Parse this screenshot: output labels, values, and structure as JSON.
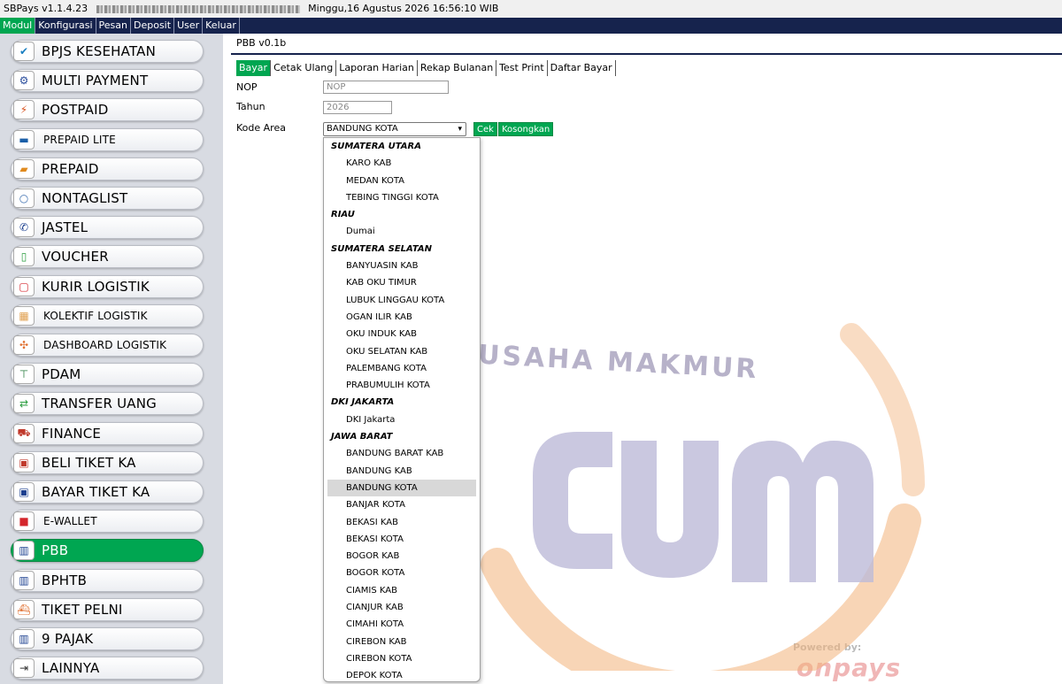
{
  "titlebar": {
    "app": "SBPays v1.1.4.23",
    "datetime": "Minggu,16 Agustus 2026 16:56:10 WIB"
  },
  "menu": [
    {
      "label": "Modul",
      "active": true
    },
    {
      "label": "Konfigurasi",
      "active": false
    },
    {
      "label": "Pesan",
      "active": false
    },
    {
      "label": "Deposit",
      "active": false
    },
    {
      "label": "User",
      "active": false
    },
    {
      "label": "Keluar",
      "active": false
    }
  ],
  "sidebar": {
    "items": [
      {
        "label": "BPJS KESEHATAN",
        "icon": "check-badge-icon",
        "glyph": "✔",
        "color": "#1a7fc1"
      },
      {
        "label": "MULTI PAYMENT",
        "icon": "multi-payment-icon",
        "glyph": "⚙",
        "color": "#2a4d9c"
      },
      {
        "label": "POSTPAID",
        "icon": "lightning-icon",
        "glyph": "⚡",
        "color": "#d9531e"
      },
      {
        "label": "PREPAID LITE",
        "icon": "wallet-icon",
        "glyph": "▬",
        "color": "#1b5fa8",
        "small": true
      },
      {
        "label": "PREPAID",
        "icon": "card-icon",
        "glyph": "▰",
        "color": "#e08a1e"
      },
      {
        "label": "NONTAGLIST",
        "icon": "bulb-icon",
        "glyph": "○",
        "color": "#3d6fb0"
      },
      {
        "label": "JASTEL",
        "icon": "phone-icon",
        "glyph": "✆",
        "color": "#1b3f8f"
      },
      {
        "label": "VOUCHER",
        "icon": "mobile-icon",
        "glyph": "▯",
        "color": "#2a9d3f"
      },
      {
        "label": "KURIR LOGISTIK",
        "icon": "box-icon",
        "glyph": "▢",
        "color": "#d4262c"
      },
      {
        "label": "KOLEKTIF LOGISTIK",
        "icon": "parcel-icon",
        "glyph": "▦",
        "color": "#e0a050",
        "small": true
      },
      {
        "label": "DASHBOARD LOGISTIK",
        "icon": "dashboard-icon",
        "glyph": "✣",
        "color": "#e07030",
        "small": true
      },
      {
        "label": "PDAM",
        "icon": "water-tap-icon",
        "glyph": "⊤",
        "color": "#2a7d3f"
      },
      {
        "label": "TRANSFER UANG",
        "icon": "money-transfer-icon",
        "glyph": "⇄",
        "color": "#2a9d3f"
      },
      {
        "label": "FINANCE",
        "icon": "vehicle-icon",
        "glyph": "⛟",
        "color": "#c0392b"
      },
      {
        "label": "BELI TIKET KA",
        "icon": "train-icon",
        "glyph": "▣",
        "color": "#c0392b"
      },
      {
        "label": "BAYAR TIKET KA",
        "icon": "train-icon",
        "glyph": "▣",
        "color": "#1b3f8f"
      },
      {
        "label": "E-WALLET",
        "icon": "ewallet-icon",
        "glyph": "■",
        "color": "#d4262c",
        "small": true
      },
      {
        "label": "PBB",
        "icon": "building-icon",
        "glyph": "▥",
        "color": "#1b3f8f",
        "active": true
      },
      {
        "label": "BPHTB",
        "icon": "building-icon",
        "glyph": "▥",
        "color": "#1b3f8f"
      },
      {
        "label": "TIKET PELNI",
        "icon": "ship-icon",
        "glyph": "⛴",
        "color": "#e07030"
      },
      {
        "label": "9 PAJAK",
        "icon": "building-icon",
        "glyph": "▥",
        "color": "#1b3f8f"
      },
      {
        "label": "LAINNYA",
        "icon": "arrow-circle-icon",
        "glyph": "⇥",
        "color": "#333333"
      }
    ]
  },
  "main": {
    "title": "PBB v0.1b",
    "tabs": [
      {
        "label": "Bayar",
        "active": true
      },
      {
        "label": "Cetak Ulang",
        "active": false
      },
      {
        "label": "Laporan Harian",
        "active": false
      },
      {
        "label": "Rekap Bulanan",
        "active": false
      },
      {
        "label": "Test Print",
        "active": false
      },
      {
        "label": "Daftar Bayar",
        "active": false
      }
    ],
    "form": {
      "nop_label": "NOP",
      "nop_placeholder": "NOP",
      "tahun_label": "Tahun",
      "tahun_value": "2026",
      "area_label": "Kode Area",
      "area_selected": "BANDUNG KOTA",
      "cek_label": "Cek",
      "kosongkan_label": "Kosongkan"
    },
    "dropdown": [
      {
        "text": "SUMATERA UTARA",
        "group": true
      },
      {
        "text": "KARO KAB"
      },
      {
        "text": "MEDAN KOTA"
      },
      {
        "text": "TEBING TINGGI KOTA"
      },
      {
        "text": "RIAU",
        "group": true
      },
      {
        "text": "Dumai"
      },
      {
        "text": "SUMATERA SELATAN",
        "group": true
      },
      {
        "text": "BANYUASIN KAB"
      },
      {
        "text": "KAB OKU TIMUR"
      },
      {
        "text": "LUBUK LINGGAU KOTA"
      },
      {
        "text": "OGAN ILIR KAB"
      },
      {
        "text": "OKU INDUK KAB"
      },
      {
        "text": "OKU SELATAN KAB"
      },
      {
        "text": "PALEMBANG KOTA"
      },
      {
        "text": "PRABUMULIH KOTA"
      },
      {
        "text": "DKI JAKARTA",
        "group": true
      },
      {
        "text": "DKI Jakarta"
      },
      {
        "text": "JAWA BARAT",
        "group": true
      },
      {
        "text": "BANDUNG BARAT KAB"
      },
      {
        "text": "BANDUNG KAB"
      },
      {
        "text": "BANDUNG KOTA",
        "selected": true
      },
      {
        "text": "BANJAR KOTA"
      },
      {
        "text": "BEKASI KAB"
      },
      {
        "text": "BEKASI KOTA"
      },
      {
        "text": "BOGOR KAB"
      },
      {
        "text": "BOGOR KOTA"
      },
      {
        "text": "CIAMIS KAB"
      },
      {
        "text": "CIANJUR KAB"
      },
      {
        "text": "CIMAHI KOTA"
      },
      {
        "text": "CIREBON KAB"
      },
      {
        "text": "CIREBON KOTA"
      },
      {
        "text": "DEPOK KOTA"
      }
    ],
    "watermark": {
      "tagline": "USAHA MAKMUR",
      "powered_by": "Powered by:",
      "brand": "onpays",
      "accent": "#f2b27a",
      "letters": "#bdbad8"
    }
  },
  "colors": {
    "accent_green": "#00a651",
    "navy": "#16234d"
  }
}
